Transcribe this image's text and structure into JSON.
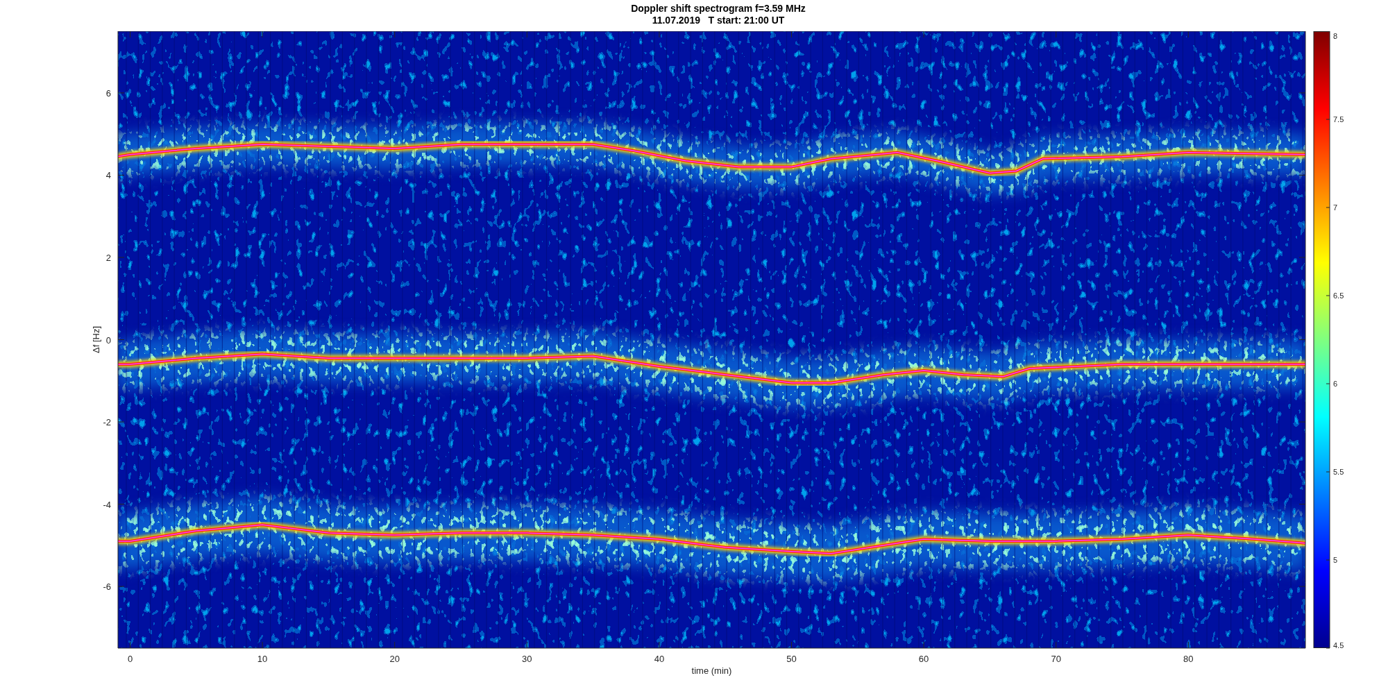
{
  "title": {
    "lines": [
      "Doppler shift spectrogram f=3.59 MHz",
      "11.07.2019   T start: 21:00 UT"
    ]
  },
  "plot": {
    "xlabel": "time (min)",
    "ylabel": "Δf [Hz]",
    "xticks": [
      "0",
      "10",
      "20",
      "30",
      "40",
      "50",
      "60",
      "70",
      "80"
    ],
    "yticks": [
      "6",
      "4",
      "2",
      "0",
      "-2",
      "-4",
      "-6"
    ]
  },
  "colorbar": {
    "ticks": [
      "8",
      "7.5",
      "7",
      "6.5",
      "6",
      "5.5",
      "5",
      "4.5"
    ]
  }
}
